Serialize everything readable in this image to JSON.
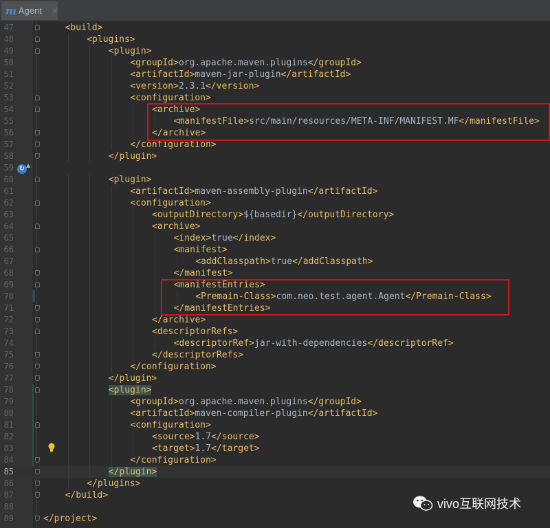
{
  "tab": {
    "label": "Agent",
    "icon": "maven-m-icon",
    "icon_letter": "m",
    "close": "×"
  },
  "editor": {
    "lines": [
      {
        "num": "47",
        "indent": 1,
        "parts": [
          [
            "tag",
            "<build>"
          ]
        ]
      },
      {
        "num": "48",
        "indent": 2,
        "parts": [
          [
            "tag",
            "<plugins>"
          ]
        ]
      },
      {
        "num": "49",
        "indent": 3,
        "parts": [
          [
            "tag",
            "<plugin>"
          ]
        ]
      },
      {
        "num": "50",
        "indent": 4,
        "parts": [
          [
            "tag",
            "<groupId>"
          ],
          [
            "txt",
            "org.apache.maven.plugins"
          ],
          [
            "tag",
            "</groupId>"
          ]
        ]
      },
      {
        "num": "51",
        "indent": 4,
        "parts": [
          [
            "tag",
            "<artifactId>"
          ],
          [
            "txt",
            "maven-jar-plugin"
          ],
          [
            "tag",
            "</artifactId>"
          ]
        ]
      },
      {
        "num": "52",
        "indent": 4,
        "parts": [
          [
            "tag",
            "<version>"
          ],
          [
            "txt",
            "2.3.1"
          ],
          [
            "tag",
            "</version>"
          ]
        ]
      },
      {
        "num": "53",
        "indent": 4,
        "parts": [
          [
            "tag",
            "<configuration>"
          ]
        ]
      },
      {
        "num": "54",
        "indent": 5,
        "parts": [
          [
            "tag",
            "<archive>"
          ]
        ]
      },
      {
        "num": "55",
        "indent": 6,
        "parts": [
          [
            "tag",
            "<manifestFile>"
          ],
          [
            "txt",
            "src/main/resources/META-INF/MANIFEST.MF"
          ],
          [
            "tag",
            "</manifestFile>"
          ]
        ]
      },
      {
        "num": "56",
        "indent": 5,
        "parts": [
          [
            "tag",
            "</archive>"
          ]
        ]
      },
      {
        "num": "57",
        "indent": 4,
        "parts": [
          [
            "tag",
            "</configuration>"
          ]
        ]
      },
      {
        "num": "58",
        "indent": 3,
        "parts": [
          [
            "tag",
            "</plugin>"
          ]
        ]
      },
      {
        "num": "59",
        "indent": 0,
        "parts": []
      },
      {
        "num": "60",
        "indent": 3,
        "parts": [
          [
            "tag",
            "<plugin>"
          ]
        ]
      },
      {
        "num": "61",
        "indent": 4,
        "parts": [
          [
            "tag",
            "<artifactId>"
          ],
          [
            "txt",
            "maven-assembly-plugin"
          ],
          [
            "tag",
            "</artifactId>"
          ]
        ]
      },
      {
        "num": "62",
        "indent": 4,
        "parts": [
          [
            "tag",
            "<configuration>"
          ]
        ]
      },
      {
        "num": "63",
        "indent": 5,
        "parts": [
          [
            "tag",
            "<outputDirectory>"
          ],
          [
            "txt",
            "${basedir}"
          ],
          [
            "tag",
            "</outputDirectory>"
          ]
        ]
      },
      {
        "num": "64",
        "indent": 5,
        "parts": [
          [
            "tag",
            "<archive>"
          ]
        ]
      },
      {
        "num": "65",
        "indent": 6,
        "parts": [
          [
            "tag",
            "<index>"
          ],
          [
            "txt",
            "true"
          ],
          [
            "tag",
            "</index>"
          ]
        ]
      },
      {
        "num": "66",
        "indent": 6,
        "parts": [
          [
            "tag",
            "<manifest>"
          ]
        ]
      },
      {
        "num": "67",
        "indent": 7,
        "parts": [
          [
            "tag",
            "<addClasspath>"
          ],
          [
            "txt",
            "true"
          ],
          [
            "tag",
            "</addClasspath>"
          ]
        ]
      },
      {
        "num": "68",
        "indent": 6,
        "parts": [
          [
            "tag",
            "</manifest>"
          ]
        ]
      },
      {
        "num": "69",
        "indent": 6,
        "parts": [
          [
            "tag",
            "<manifestEntries>"
          ]
        ]
      },
      {
        "num": "70",
        "indent": 7,
        "parts": [
          [
            "tag",
            "<Premain-Class>"
          ],
          [
            "txt",
            "com.neo.test.agent.Agent"
          ],
          [
            "tag",
            "</Premain-Class>"
          ]
        ]
      },
      {
        "num": "71",
        "indent": 6,
        "parts": [
          [
            "tag",
            "</manifestEntries>"
          ]
        ]
      },
      {
        "num": "72",
        "indent": 5,
        "parts": [
          [
            "tag",
            "</archive>"
          ]
        ]
      },
      {
        "num": "73",
        "indent": 5,
        "parts": [
          [
            "tag",
            "<descriptorRefs>"
          ]
        ]
      },
      {
        "num": "74",
        "indent": 6,
        "parts": [
          [
            "tag",
            "<descriptorRef>"
          ],
          [
            "txt",
            "jar-with-dependencies"
          ],
          [
            "tag",
            "</descriptorRef>"
          ]
        ]
      },
      {
        "num": "75",
        "indent": 5,
        "parts": [
          [
            "tag",
            "</descriptorRefs>"
          ]
        ]
      },
      {
        "num": "76",
        "indent": 4,
        "parts": [
          [
            "tag",
            "</configuration>"
          ]
        ]
      },
      {
        "num": "77",
        "indent": 3,
        "parts": [
          [
            "tag",
            "</plugin>"
          ]
        ]
      },
      {
        "num": "78",
        "indent": 3,
        "parts": [
          [
            "taghl",
            "<plugin>"
          ]
        ]
      },
      {
        "num": "79",
        "indent": 4,
        "parts": [
          [
            "tag",
            "<groupId>"
          ],
          [
            "txt",
            "org.apache.maven.plugins"
          ],
          [
            "tag",
            "</groupId>"
          ]
        ]
      },
      {
        "num": "80",
        "indent": 4,
        "parts": [
          [
            "tag",
            "<artifactId>"
          ],
          [
            "txt",
            "maven-compiler-plugin"
          ],
          [
            "tag",
            "</artifactId>"
          ]
        ]
      },
      {
        "num": "81",
        "indent": 4,
        "parts": [
          [
            "tag",
            "<configuration>"
          ]
        ]
      },
      {
        "num": "82",
        "indent": 5,
        "parts": [
          [
            "tag",
            "<source>"
          ],
          [
            "txt",
            "1.7"
          ],
          [
            "tag",
            "</source>"
          ]
        ]
      },
      {
        "num": "83",
        "indent": 5,
        "parts": [
          [
            "tag",
            "<target>"
          ],
          [
            "txt",
            "1.7"
          ],
          [
            "tag",
            "</target>"
          ]
        ]
      },
      {
        "num": "84",
        "indent": 4,
        "parts": [
          [
            "tag",
            "</configuration>"
          ]
        ]
      },
      {
        "num": "85",
        "indent": 3,
        "parts": [
          [
            "taghl",
            "</plugin>"
          ]
        ]
      },
      {
        "num": "86",
        "indent": 2,
        "parts": [
          [
            "tag",
            "</plugins>"
          ]
        ]
      },
      {
        "num": "87",
        "indent": 1,
        "parts": [
          [
            "tag",
            "</build>"
          ]
        ]
      },
      {
        "num": "88",
        "indent": 0,
        "parts": []
      },
      {
        "num": "89",
        "indent": 0,
        "parts": [
          [
            "tag",
            "</project>"
          ]
        ]
      }
    ],
    "current_line": "85",
    "fold_markers": [
      "47",
      "48",
      "49",
      "53",
      "54",
      "56",
      "57",
      "58",
      "60",
      "62",
      "64",
      "66",
      "68",
      "69",
      "71",
      "72",
      "73",
      "75",
      "76",
      "77",
      "78",
      "81",
      "84",
      "85",
      "86",
      "87",
      "89"
    ],
    "gutter_icons": {
      "run_gutter": "maven-reload-icon",
      "intention": "lightbulb-icon"
    }
  },
  "annotations": {
    "highlight_color": "#c8161d"
  },
  "watermark": {
    "text": "vivo互联网技术",
    "icon": "wechat-icon"
  },
  "colors": {
    "background": "#2b2b2b",
    "tag": "#e8bf6a",
    "text": "#a9b7c6",
    "gutter": "#313335"
  }
}
